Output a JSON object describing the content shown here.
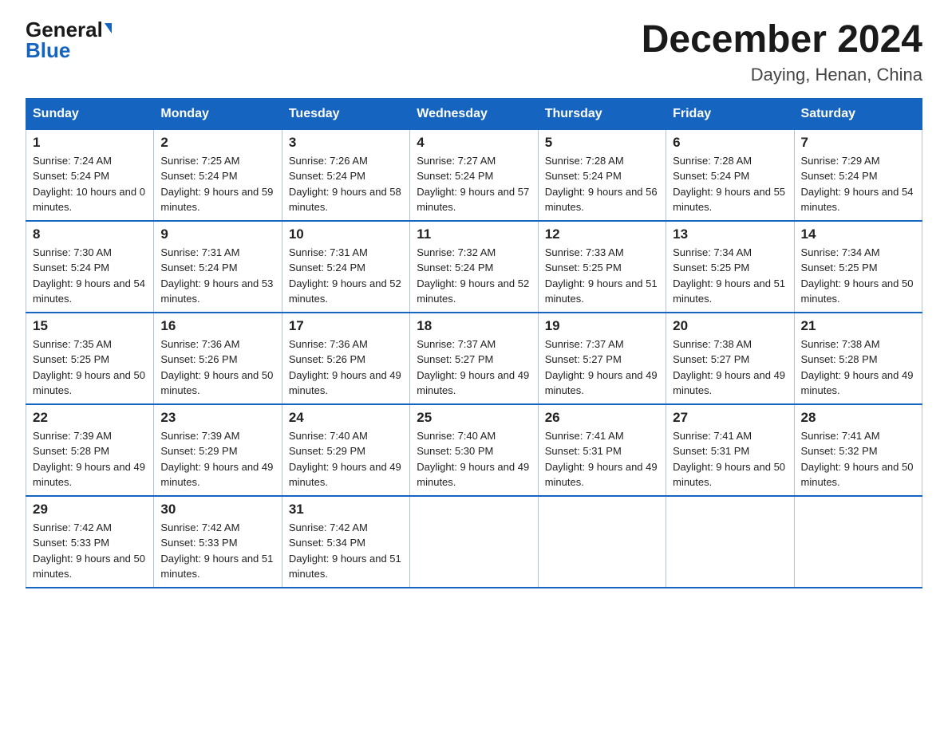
{
  "logo": {
    "general": "General",
    "blue": "Blue",
    "triangle": "▲"
  },
  "header": {
    "month": "December 2024",
    "location": "Daying, Henan, China"
  },
  "days_of_week": [
    "Sunday",
    "Monday",
    "Tuesday",
    "Wednesday",
    "Thursday",
    "Friday",
    "Saturday"
  ],
  "weeks": [
    [
      {
        "day": "1",
        "sunrise": "7:24 AM",
        "sunset": "5:24 PM",
        "daylight": "10 hours and 0 minutes."
      },
      {
        "day": "2",
        "sunrise": "7:25 AM",
        "sunset": "5:24 PM",
        "daylight": "9 hours and 59 minutes."
      },
      {
        "day": "3",
        "sunrise": "7:26 AM",
        "sunset": "5:24 PM",
        "daylight": "9 hours and 58 minutes."
      },
      {
        "day": "4",
        "sunrise": "7:27 AM",
        "sunset": "5:24 PM",
        "daylight": "9 hours and 57 minutes."
      },
      {
        "day": "5",
        "sunrise": "7:28 AM",
        "sunset": "5:24 PM",
        "daylight": "9 hours and 56 minutes."
      },
      {
        "day": "6",
        "sunrise": "7:28 AM",
        "sunset": "5:24 PM",
        "daylight": "9 hours and 55 minutes."
      },
      {
        "day": "7",
        "sunrise": "7:29 AM",
        "sunset": "5:24 PM",
        "daylight": "9 hours and 54 minutes."
      }
    ],
    [
      {
        "day": "8",
        "sunrise": "7:30 AM",
        "sunset": "5:24 PM",
        "daylight": "9 hours and 54 minutes."
      },
      {
        "day": "9",
        "sunrise": "7:31 AM",
        "sunset": "5:24 PM",
        "daylight": "9 hours and 53 minutes."
      },
      {
        "day": "10",
        "sunrise": "7:31 AM",
        "sunset": "5:24 PM",
        "daylight": "9 hours and 52 minutes."
      },
      {
        "day": "11",
        "sunrise": "7:32 AM",
        "sunset": "5:24 PM",
        "daylight": "9 hours and 52 minutes."
      },
      {
        "day": "12",
        "sunrise": "7:33 AM",
        "sunset": "5:25 PM",
        "daylight": "9 hours and 51 minutes."
      },
      {
        "day": "13",
        "sunrise": "7:34 AM",
        "sunset": "5:25 PM",
        "daylight": "9 hours and 51 minutes."
      },
      {
        "day": "14",
        "sunrise": "7:34 AM",
        "sunset": "5:25 PM",
        "daylight": "9 hours and 50 minutes."
      }
    ],
    [
      {
        "day": "15",
        "sunrise": "7:35 AM",
        "sunset": "5:25 PM",
        "daylight": "9 hours and 50 minutes."
      },
      {
        "day": "16",
        "sunrise": "7:36 AM",
        "sunset": "5:26 PM",
        "daylight": "9 hours and 50 minutes."
      },
      {
        "day": "17",
        "sunrise": "7:36 AM",
        "sunset": "5:26 PM",
        "daylight": "9 hours and 49 minutes."
      },
      {
        "day": "18",
        "sunrise": "7:37 AM",
        "sunset": "5:27 PM",
        "daylight": "9 hours and 49 minutes."
      },
      {
        "day": "19",
        "sunrise": "7:37 AM",
        "sunset": "5:27 PM",
        "daylight": "9 hours and 49 minutes."
      },
      {
        "day": "20",
        "sunrise": "7:38 AM",
        "sunset": "5:27 PM",
        "daylight": "9 hours and 49 minutes."
      },
      {
        "day": "21",
        "sunrise": "7:38 AM",
        "sunset": "5:28 PM",
        "daylight": "9 hours and 49 minutes."
      }
    ],
    [
      {
        "day": "22",
        "sunrise": "7:39 AM",
        "sunset": "5:28 PM",
        "daylight": "9 hours and 49 minutes."
      },
      {
        "day": "23",
        "sunrise": "7:39 AM",
        "sunset": "5:29 PM",
        "daylight": "9 hours and 49 minutes."
      },
      {
        "day": "24",
        "sunrise": "7:40 AM",
        "sunset": "5:29 PM",
        "daylight": "9 hours and 49 minutes."
      },
      {
        "day": "25",
        "sunrise": "7:40 AM",
        "sunset": "5:30 PM",
        "daylight": "9 hours and 49 minutes."
      },
      {
        "day": "26",
        "sunrise": "7:41 AM",
        "sunset": "5:31 PM",
        "daylight": "9 hours and 49 minutes."
      },
      {
        "day": "27",
        "sunrise": "7:41 AM",
        "sunset": "5:31 PM",
        "daylight": "9 hours and 50 minutes."
      },
      {
        "day": "28",
        "sunrise": "7:41 AM",
        "sunset": "5:32 PM",
        "daylight": "9 hours and 50 minutes."
      }
    ],
    [
      {
        "day": "29",
        "sunrise": "7:42 AM",
        "sunset": "5:33 PM",
        "daylight": "9 hours and 50 minutes."
      },
      {
        "day": "30",
        "sunrise": "7:42 AM",
        "sunset": "5:33 PM",
        "daylight": "9 hours and 51 minutes."
      },
      {
        "day": "31",
        "sunrise": "7:42 AM",
        "sunset": "5:34 PM",
        "daylight": "9 hours and 51 minutes."
      },
      null,
      null,
      null,
      null
    ]
  ]
}
